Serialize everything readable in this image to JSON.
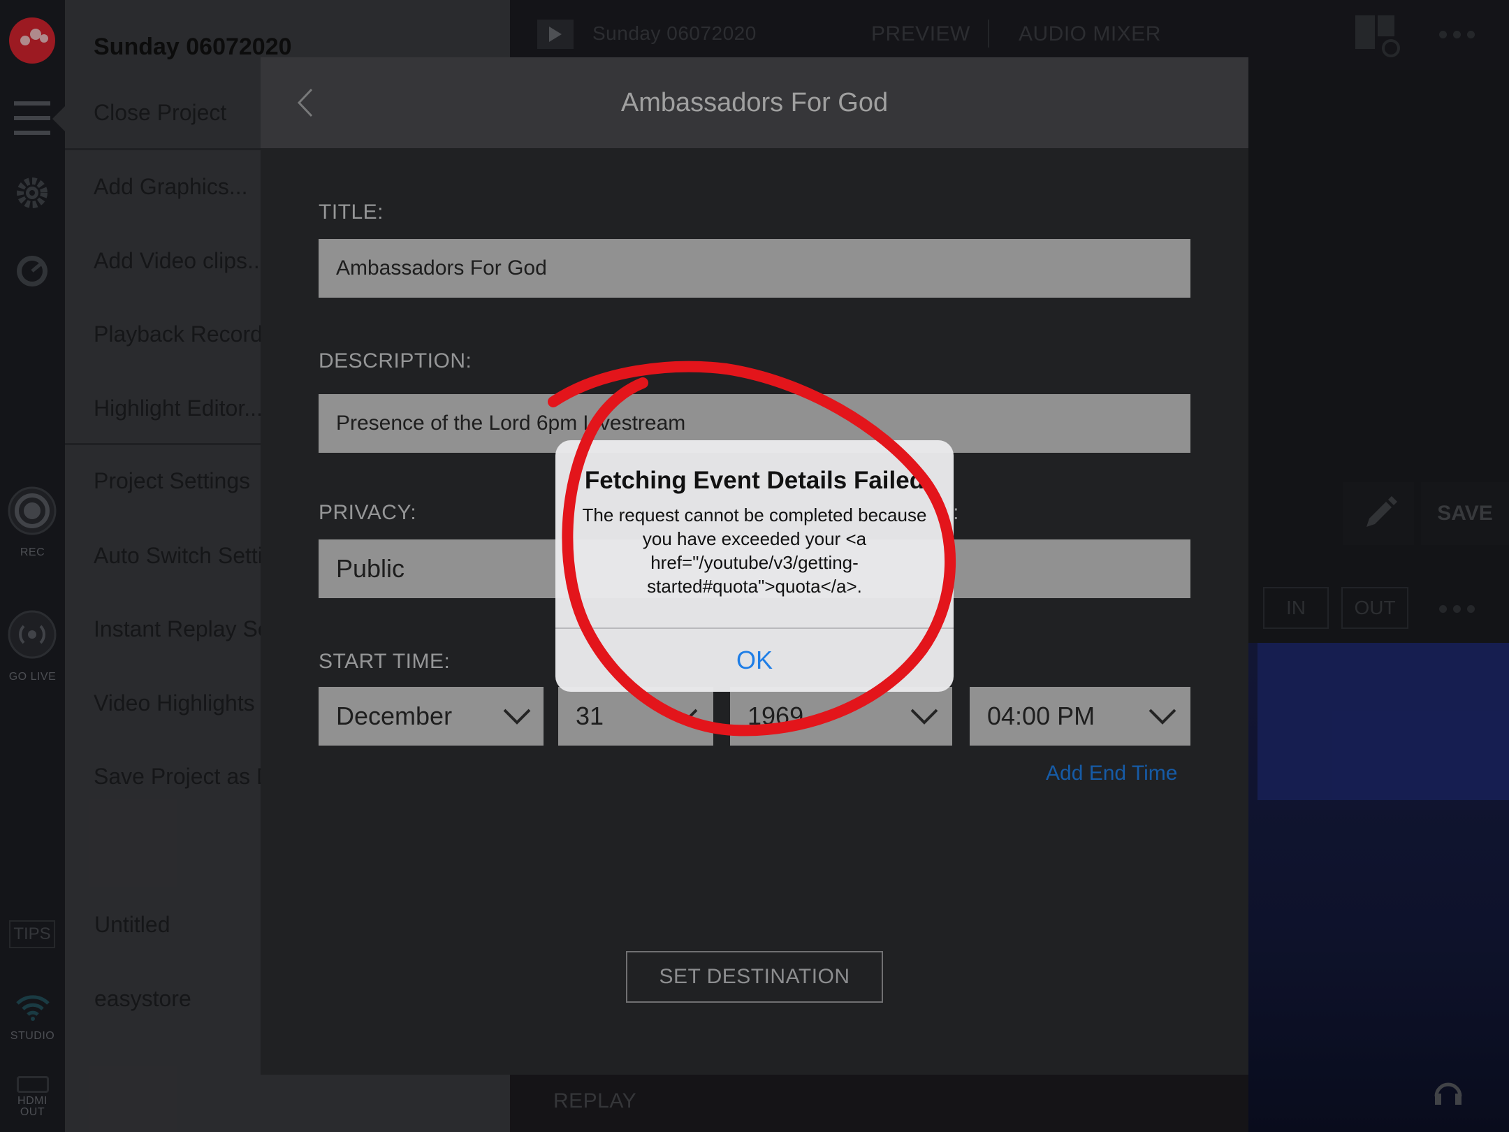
{
  "colors": {
    "accent_blue": "#1f7ee6",
    "alert_circle_red": "#e3151b",
    "logo_red": "#d92530"
  },
  "rail": {
    "rec_label": "REC",
    "go_live_label": "GO LIVE",
    "tips_label": "TIPS",
    "studio_label": "STUDIO",
    "hdmi_label": "HDMI\nOUT"
  },
  "menu": {
    "project_title": "Sunday 06072020",
    "items": [
      {
        "label": "Close Project"
      },
      {
        "label": "Add Graphics..."
      },
      {
        "label": "Add Video clips..."
      },
      {
        "label": "Playback Recordings"
      },
      {
        "label": "Highlight Editor..."
      },
      {
        "label": "Project Settings"
      },
      {
        "label": "Auto Switch Settings"
      },
      {
        "label": "Instant Replay Settings"
      },
      {
        "label": "Video Highlights"
      },
      {
        "label": "Save Project as Default"
      }
    ],
    "storage": [
      {
        "label": "Untitled"
      },
      {
        "label": "easystore"
      }
    ]
  },
  "topbar": {
    "project_name": "Sunday 06072020",
    "preview_label": "PREVIEW",
    "audio_mixer_label": "AUDIO MIXER",
    "save_label": "SAVE",
    "in_label": "IN",
    "out_label": "OUT",
    "replay_label": "REPLAY"
  },
  "modal": {
    "title": "Ambassadors For God",
    "title_label": "TITLE:",
    "title_value": "Ambassadors For God",
    "description_label": "DESCRIPTION:",
    "description_value": "Presence of the Lord 6pm Livestream",
    "privacy_label": "PRIVACY:",
    "privacy_value": "Public",
    "second_label_tail": "l:",
    "start_time_label": "START TIME:",
    "start_month": "December",
    "start_day": "31",
    "start_year": "1969",
    "start_time": "04:00 PM",
    "add_end_time": "Add End Time",
    "set_destination": "SET DESTINATION"
  },
  "alert": {
    "title": "Fetching Event Details Failed",
    "message": "The request cannot be completed because you have exceeded your <a href=\"/youtube/v3/getting-started#quota\">quota</a>.",
    "ok_label": "OK"
  }
}
